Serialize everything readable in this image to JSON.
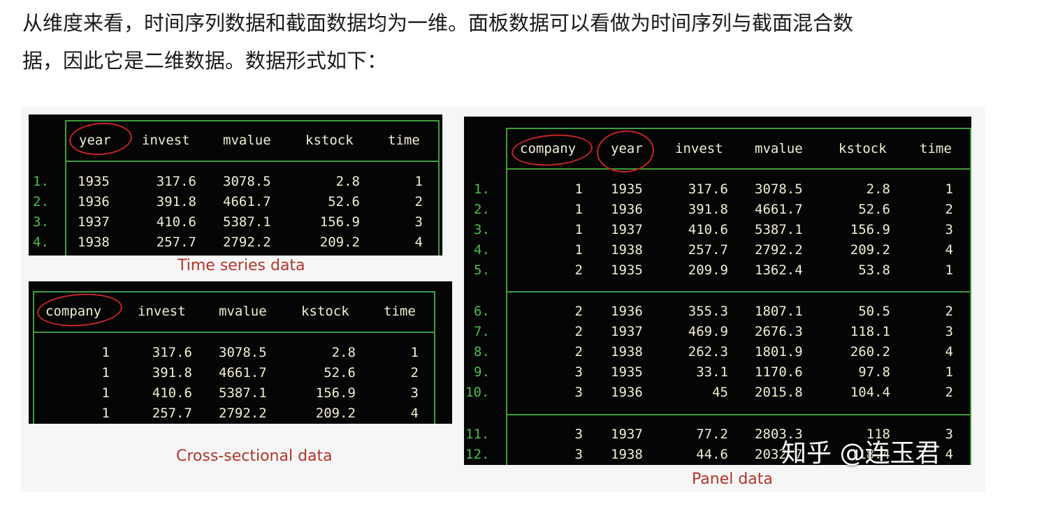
{
  "paragraph": {
    "line1": "从维度来看，时间序列数据和截面数据均为一维。面板数据可以看做为时间序列与截面混合数",
    "line2": "据，因此它是二维数据。数据形式如下："
  },
  "time_series": {
    "caption": "Time series data",
    "headers": [
      "year",
      "invest",
      "mvalue",
      "kstock",
      "time"
    ],
    "rows": [
      {
        "idx": "1.",
        "cells": [
          "1935",
          "317.6",
          "3078.5",
          "2.8",
          "1"
        ]
      },
      {
        "idx": "2.",
        "cells": [
          "1936",
          "391.8",
          "4661.7",
          "52.6",
          "2"
        ]
      },
      {
        "idx": "3.",
        "cells": [
          "1937",
          "410.6",
          "5387.1",
          "156.9",
          "3"
        ]
      },
      {
        "idx": "4.",
        "cells": [
          "1938",
          "257.7",
          "2792.2",
          "209.2",
          "4"
        ]
      }
    ]
  },
  "cross_section": {
    "caption": "Cross-sectional data",
    "headers": [
      "company",
      "invest",
      "mvalue",
      "kstock",
      "time"
    ],
    "rows": [
      {
        "cells": [
          "1",
          "317.6",
          "3078.5",
          "2.8",
          "1"
        ]
      },
      {
        "cells": [
          "1",
          "391.8",
          "4661.7",
          "52.6",
          "2"
        ]
      },
      {
        "cells": [
          "1",
          "410.6",
          "5387.1",
          "156.9",
          "3"
        ]
      },
      {
        "cells": [
          "1",
          "257.7",
          "2792.2",
          "209.2",
          "4"
        ]
      }
    ]
  },
  "panel": {
    "caption": "Panel data",
    "headers": [
      "company",
      "year",
      "invest",
      "mvalue",
      "kstock",
      "time"
    ],
    "rows": [
      {
        "idx": "1.",
        "cells": [
          "1",
          "1935",
          "317.6",
          "3078.5",
          "2.8",
          "1"
        ]
      },
      {
        "idx": "2.",
        "cells": [
          "1",
          "1936",
          "391.8",
          "4661.7",
          "52.6",
          "2"
        ]
      },
      {
        "idx": "3.",
        "cells": [
          "1",
          "1937",
          "410.6",
          "5387.1",
          "156.9",
          "3"
        ]
      },
      {
        "idx": "4.",
        "cells": [
          "1",
          "1938",
          "257.7",
          "2792.2",
          "209.2",
          "4"
        ]
      },
      {
        "idx": "5.",
        "cells": [
          "2",
          "1935",
          "209.9",
          "1362.4",
          "53.8",
          "1"
        ]
      },
      {
        "idx": "6.",
        "cells": [
          "2",
          "1936",
          "355.3",
          "1807.1",
          "50.5",
          "2"
        ]
      },
      {
        "idx": "7.",
        "cells": [
          "2",
          "1937",
          "469.9",
          "2676.3",
          "118.1",
          "3"
        ]
      },
      {
        "idx": "8.",
        "cells": [
          "2",
          "1938",
          "262.3",
          "1801.9",
          "260.2",
          "4"
        ]
      },
      {
        "idx": "9.",
        "cells": [
          "3",
          "1935",
          "33.1",
          "1170.6",
          "97.8",
          "1"
        ]
      },
      {
        "idx": "10.",
        "cells": [
          "3",
          "1936",
          "45",
          "2015.8",
          "104.4",
          "2"
        ]
      },
      {
        "idx": "11.",
        "cells": [
          "3",
          "1937",
          "77.2",
          "2803.3",
          "118",
          "3"
        ]
      },
      {
        "idx": "12.",
        "cells": [
          "3",
          "1938",
          "44.6",
          "2032.7",
          "118.4",
          "4"
        ]
      }
    ]
  },
  "watermark": "知乎 @连玉君",
  "colors": {
    "grid": "#3f9b3f",
    "index": "#4dbd4d",
    "circle": "#c42525",
    "caption": "#b3342c"
  }
}
